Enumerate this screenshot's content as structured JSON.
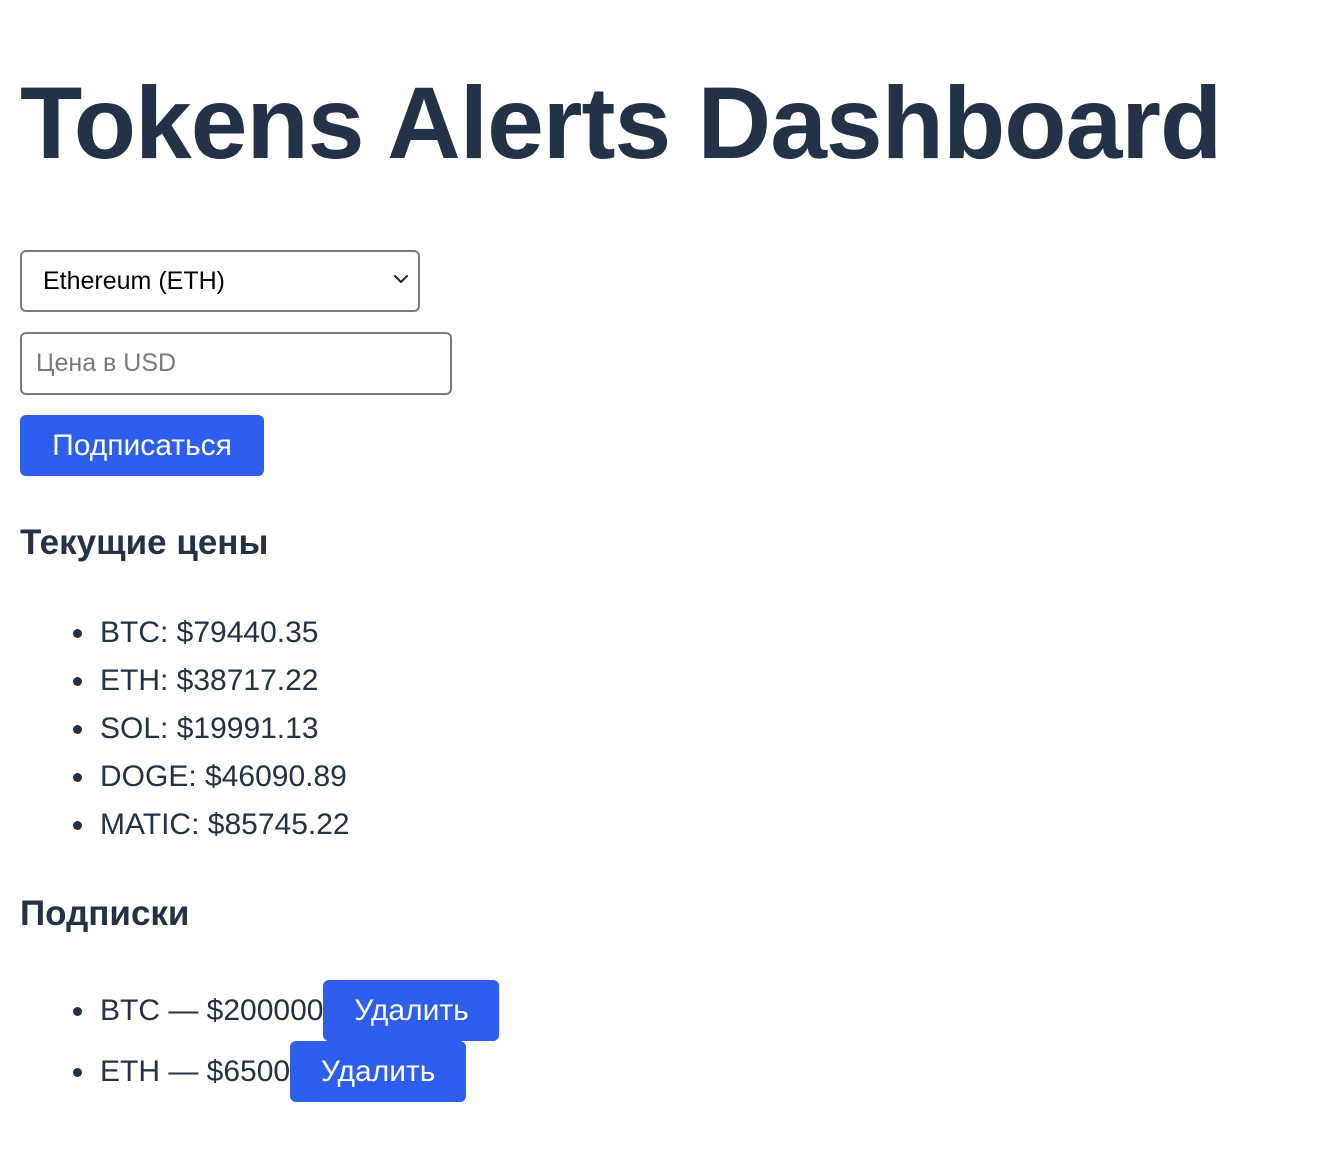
{
  "header": {
    "title": "Tokens Alerts Dashboard"
  },
  "form": {
    "token_select": {
      "selected": "Ethereum (ETH)"
    },
    "price_input": {
      "value": "",
      "placeholder": "Цена в USD"
    },
    "subscribe_label": "Подписаться"
  },
  "prices": {
    "heading": "Текущие цены",
    "items": [
      {
        "text": "BTC: $79440.35"
      },
      {
        "text": "ETH: $38717.22"
      },
      {
        "text": "SOL: $19991.13"
      },
      {
        "text": "DOGE: $46090.89"
      },
      {
        "text": "MATIC: $85745.22"
      }
    ]
  },
  "subscriptions": {
    "heading": "Подписки",
    "delete_label": "Удалить",
    "items": [
      {
        "text": "BTC — $200000"
      },
      {
        "text": "ETH — $6500"
      }
    ]
  },
  "colors": {
    "accent": "#2e5ef0",
    "text": "#233246"
  }
}
